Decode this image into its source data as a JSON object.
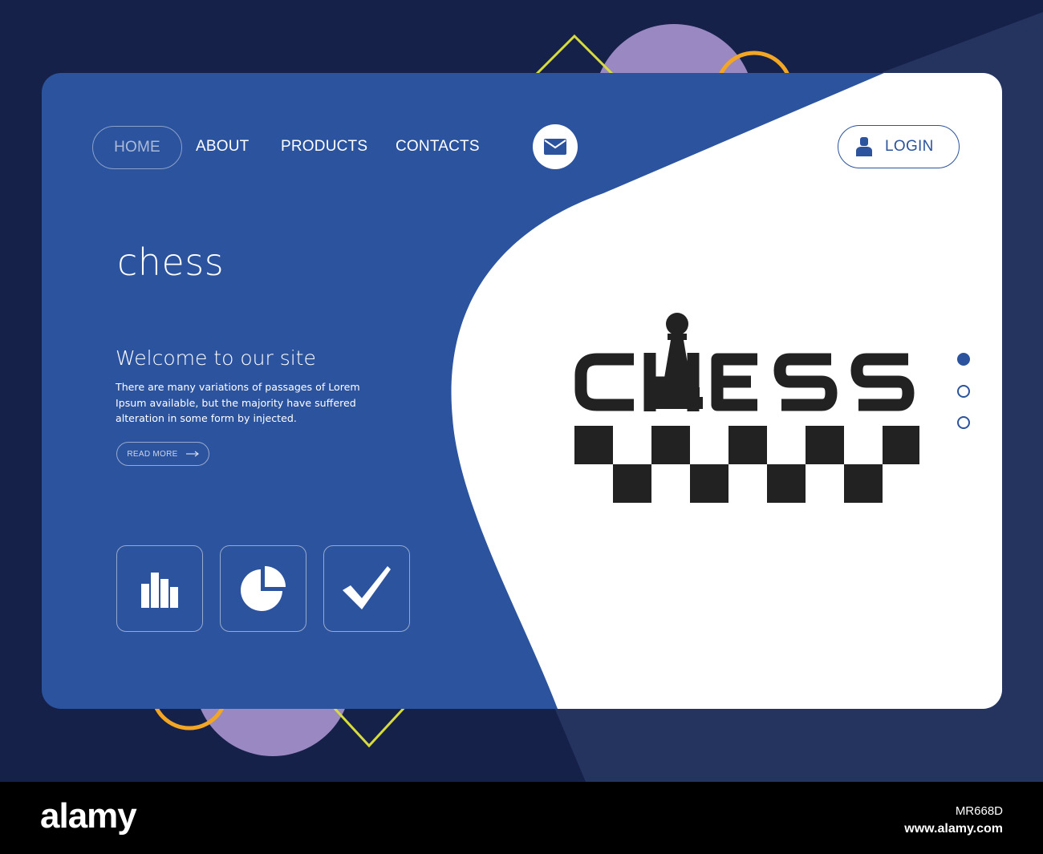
{
  "nav": {
    "home": "HOME",
    "about": "ABOUT",
    "products": "PRODUCTS",
    "contacts": "CONTACTS"
  },
  "icons": {
    "mail": "envelope-icon",
    "user": "user-icon",
    "bar_chart": "bar-chart-icon",
    "pie_chart": "pie-chart-icon",
    "check": "checkmark-icon",
    "arrow": "arrow-right-icon"
  },
  "login": {
    "label": "LOGIN"
  },
  "hero": {
    "title": "chess",
    "welcome": "Welcome to our site",
    "description": "There are many variations of passages of Lorem Ipsum available, but the majority have suffered alteration in some form by injected.",
    "read_more": "READ MORE"
  },
  "carousel": {
    "count": 3,
    "active_index": 0
  },
  "footer": {
    "brand": "alamy",
    "image_id": "MR668D",
    "url": "www.alamy.com"
  },
  "colors": {
    "background": "#16214a",
    "card_blue": "#2c539e",
    "card_white": "#ffffff",
    "purple": "#9a88c2",
    "orange": "#f2a623",
    "yellow": "#d7dc3a"
  }
}
